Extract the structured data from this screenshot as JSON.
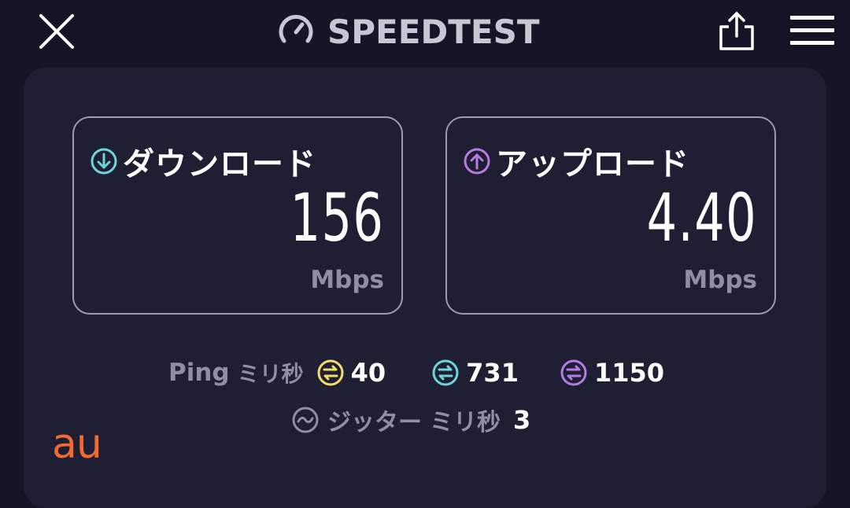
{
  "header": {
    "title": "SPEEDTEST",
    "icons": {
      "close": "close-icon",
      "logo": "speedometer-icon",
      "share": "share-icon",
      "menu": "hamburger-menu-icon"
    }
  },
  "download": {
    "label": "ダウンロード",
    "value": "156",
    "unit": "Mbps",
    "icon": "download-arrow-icon",
    "color": "#6fd3d8"
  },
  "upload": {
    "label": "アップロード",
    "value": "4.40",
    "unit": "Mbps",
    "icon": "upload-arrow-icon",
    "color": "#b57be0"
  },
  "ping": {
    "label": "Ping",
    "unit": "ミリ秒",
    "idle": {
      "value": "40",
      "color": "#f3dc6a"
    },
    "download": {
      "value": "731",
      "color": "#6fd3d8"
    },
    "upload": {
      "value": "1150",
      "color": "#b57be0"
    }
  },
  "jitter": {
    "label": "ジッター",
    "unit": "ミリ秒",
    "value": "3"
  },
  "carrier": {
    "name": "au",
    "color": "#f26a30"
  }
}
